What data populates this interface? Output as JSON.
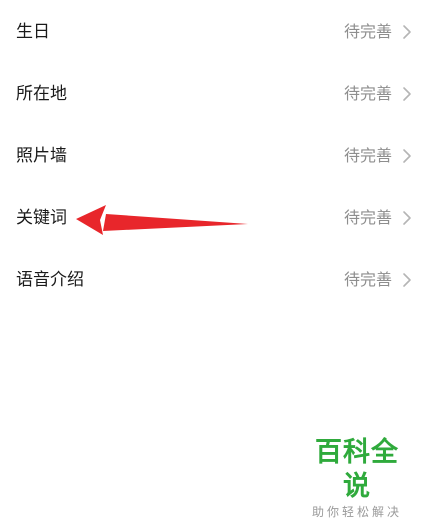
{
  "rows": [
    {
      "label": "生日",
      "value": "待完善"
    },
    {
      "label": "所在地",
      "value": "待完善"
    },
    {
      "label": "照片墙",
      "value": "待完善"
    },
    {
      "label": "关键词",
      "value": "待完善"
    },
    {
      "label": "语音介绍",
      "value": "待完善"
    }
  ],
  "icons": {
    "row_chevron": "chevron-right-icon"
  },
  "colors": {
    "label": "#1a1a1a",
    "value": "#8e8e8e",
    "arrow": "#e8262b",
    "watermark": "#2faa3c"
  },
  "watermark": {
    "title": "百科全说",
    "subtitle": "助你轻松解决"
  }
}
